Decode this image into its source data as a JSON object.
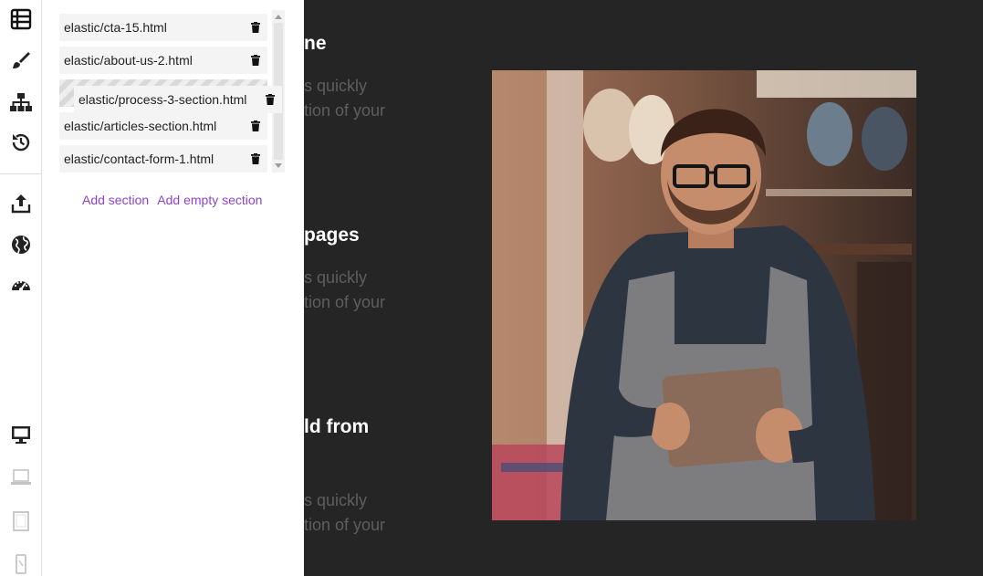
{
  "rail": {
    "top_icons": [
      "sections-icon",
      "brush-icon",
      "sitemap-icon",
      "history-icon"
    ],
    "middle_icons": [
      "export-icon",
      "globe-icon",
      "dashboard-icon"
    ],
    "device_icons": [
      "desktop-icon",
      "laptop-icon",
      "tablet-icon",
      "mobile-icon"
    ]
  },
  "sections": {
    "items": [
      "elastic/cta-15.html",
      "elastic/about-us-2.html",
      "elastic/articles-section.html",
      "elastic/contact-form-1.html"
    ],
    "dragging_item": "elastic/process-3-section.html",
    "add_section_label": "Add section",
    "add_empty_section_label": "Add empty section"
  },
  "canvas": {
    "heading_1": "ne",
    "text_1a": "s quickly",
    "text_1b": "tion of your",
    "heading_2": "pages",
    "text_2a": "s quickly",
    "text_2b": "tion of your",
    "heading_3": "ld from",
    "text_3a": "s quickly",
    "text_3b": "tion of your"
  },
  "colors": {
    "accent": "#8e44c9",
    "canvas_bg": "#252525",
    "panel_bg": "#ffffff"
  }
}
